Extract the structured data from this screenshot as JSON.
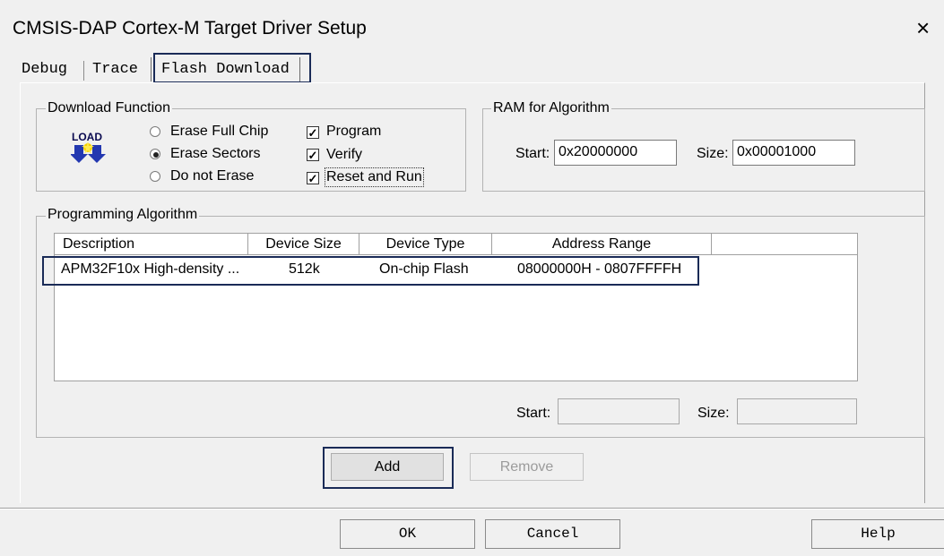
{
  "window": {
    "title": "CMSIS-DAP Cortex-M Target Driver Setup",
    "close_glyph": "×"
  },
  "tabs": [
    "Debug",
    "Trace",
    "Flash Download"
  ],
  "download_function": {
    "label": "Download Function",
    "load_icon_text": "LOAD",
    "erase_options": [
      {
        "label": "Erase Full Chip",
        "selected": false
      },
      {
        "label": "Erase Sectors",
        "selected": true
      },
      {
        "label": "Do not Erase",
        "selected": false
      }
    ],
    "checkboxes": [
      {
        "label": "Program",
        "checked": true
      },
      {
        "label": "Verify",
        "checked": true
      },
      {
        "label": "Reset and Run",
        "checked": true
      }
    ],
    "check_glyph": "✓"
  },
  "ram": {
    "label": "RAM for Algorithm",
    "start_label": "Start:",
    "start_value": "0x20000000",
    "size_label": "Size:",
    "size_value": "0x00001000"
  },
  "programming_algorithm": {
    "label": "Programming Algorithm",
    "columns": [
      "Description",
      "Device Size",
      "Device Type",
      "Address Range"
    ],
    "rows": [
      {
        "description": "APM32F10x High-density ...",
        "device_size": "512k",
        "device_type": "On-chip Flash",
        "address_range": "08000000H - 0807FFFFH"
      }
    ],
    "start_label": "Start:",
    "start_value": "",
    "size_label": "Size:",
    "size_value": ""
  },
  "buttons": {
    "add": "Add",
    "remove": "Remove",
    "ok": "OK",
    "cancel": "Cancel",
    "help": "Help"
  },
  "colors": {
    "highlight_outline": "#1a2b57",
    "background": "#f0f0f0"
  }
}
